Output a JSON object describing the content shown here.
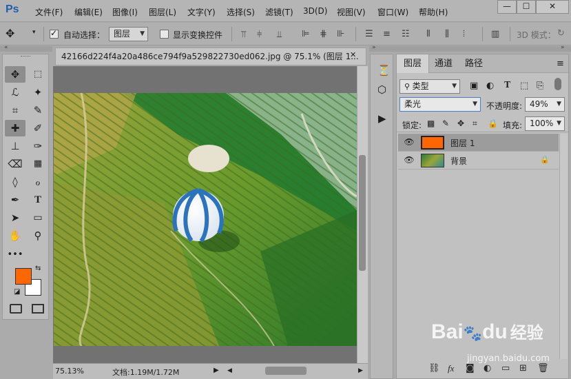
{
  "app": {
    "logo": "Ps"
  },
  "menu": [
    "文件(F)",
    "编辑(E)",
    "图像(I)",
    "图层(L)",
    "文字(Y)",
    "选择(S)",
    "滤镜(T)",
    "3D(D)",
    "视图(V)",
    "窗口(W)",
    "帮助(H)"
  ],
  "window_controls": {
    "minimize": "—",
    "restore": "☐",
    "close": "✕"
  },
  "options": {
    "auto_select_label": "自动选择：",
    "auto_select_checked": true,
    "auto_select_target": "图层",
    "show_transform_label": "显示变换控件",
    "show_transform_checked": false,
    "mode_3d_label": "3D 模式："
  },
  "document": {
    "tab_title": "42166d224f4a20a486ce794f9a529822730ed062.jpg @ 75.1% (图层 1...",
    "tab_close": "✕",
    "zoom": "75.13%",
    "doc_size": "文档:1.19M/1.72M"
  },
  "colors": {
    "foreground": "#ff6600",
    "background": "#ffffff",
    "accent": "#1f5fae",
    "layer1_fill": "#ff6600"
  },
  "layers_panel": {
    "tabs": [
      "图层",
      "通道",
      "路径"
    ],
    "active_tab": "图层",
    "filter_kind": "类型",
    "blend_mode": "柔光",
    "opacity_label": "不透明度:",
    "opacity_value": "49%",
    "lock_label": "锁定:",
    "fill_label": "填充:",
    "fill_value": "100%",
    "layers": [
      {
        "name": "图层 1",
        "visible": true,
        "selected": true,
        "locked": false
      },
      {
        "name": "背景",
        "visible": true,
        "selected": false,
        "locked": true
      }
    ]
  },
  "watermark": {
    "brand": "Bai",
    "brand2": "du",
    "cn": "经验",
    "url": "jingyan.baidu.com"
  }
}
